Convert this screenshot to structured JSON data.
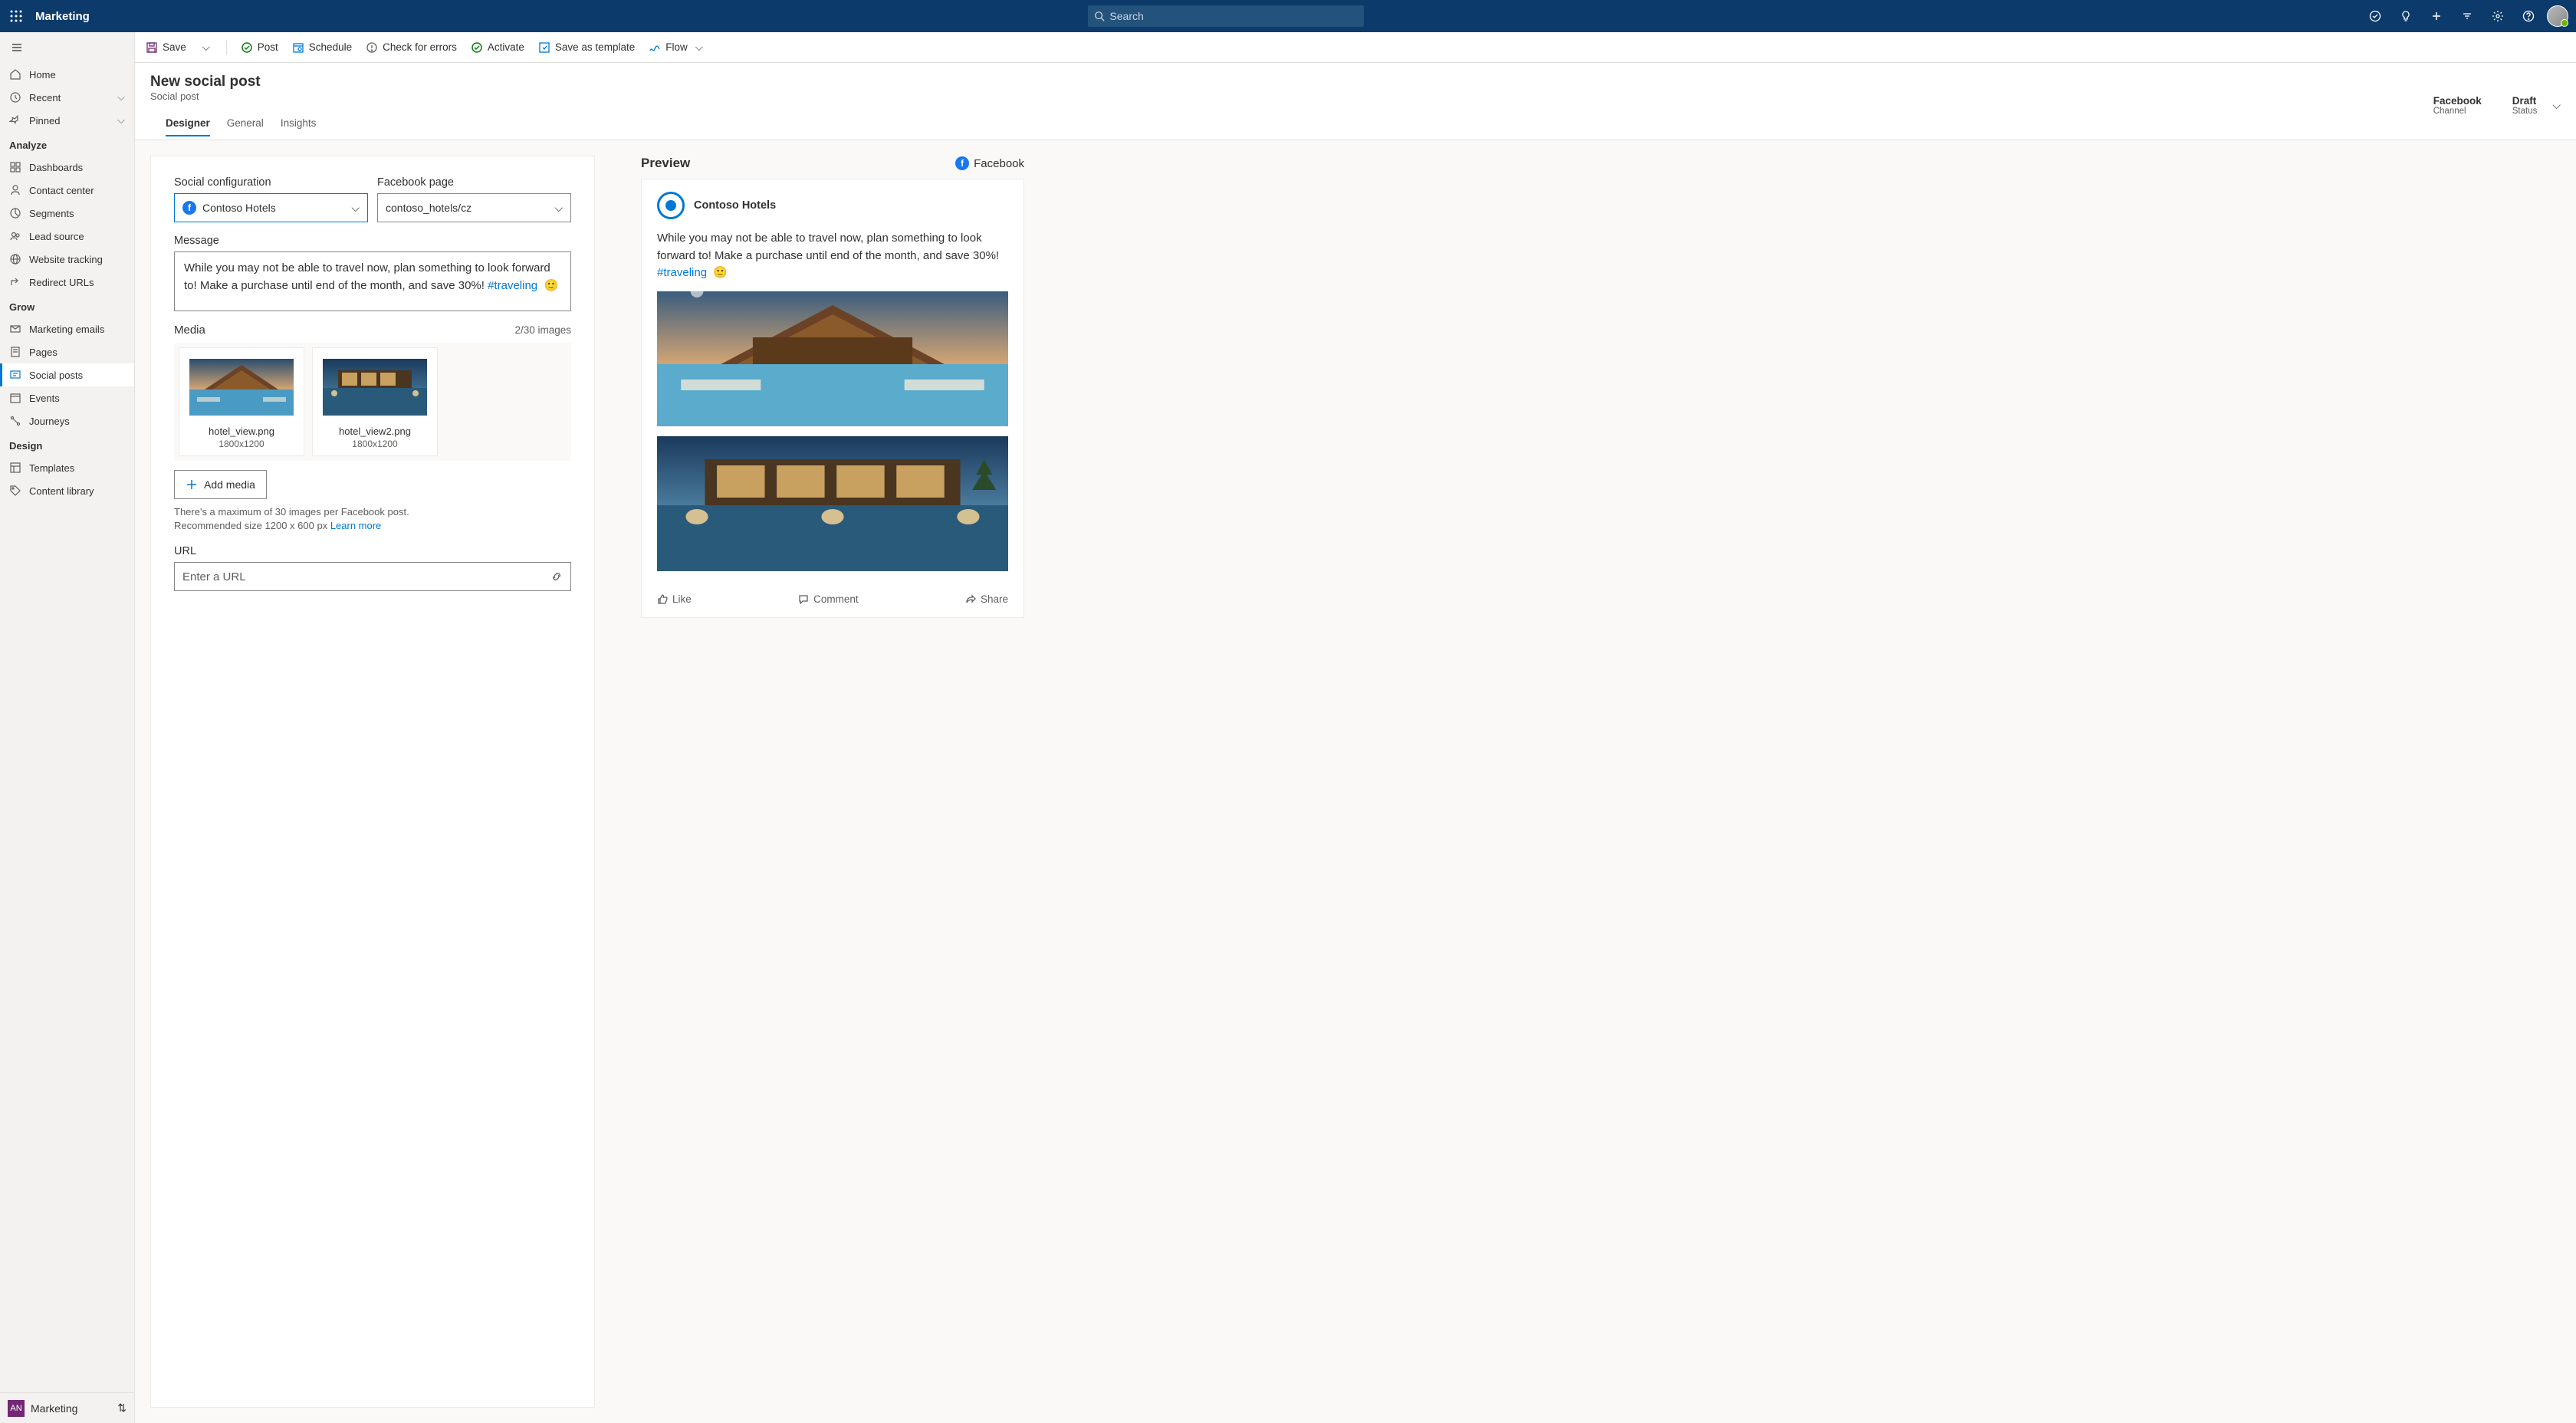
{
  "topbar": {
    "app_name": "Marketing",
    "search_placeholder": "Search"
  },
  "sidebar": {
    "home": "Home",
    "recent": "Recent",
    "pinned": "Pinned",
    "section_analyze": "Analyze",
    "analyze_items": [
      "Dashboards",
      "Contact center",
      "Segments",
      "Lead source",
      "Website tracking",
      "Redirect URLs"
    ],
    "section_grow": "Grow",
    "grow_items": [
      "Marketing emails",
      "Pages",
      "Social posts",
      "Events",
      "Journeys"
    ],
    "section_design": "Design",
    "design_items": [
      "Templates",
      "Content library"
    ],
    "footer_badge": "AN",
    "footer_label": "Marketing"
  },
  "cmdbar": {
    "save": "Save",
    "post": "Post",
    "schedule": "Schedule",
    "check": "Check for errors",
    "activate": "Activate",
    "save_tpl": "Save as template",
    "flow": "Flow"
  },
  "header": {
    "title": "New social post",
    "subtitle": "Social post",
    "channel_value": "Facebook",
    "channel_label": "Channel",
    "status_value": "Draft",
    "status_label": "Status"
  },
  "tabs": [
    "Designer",
    "General",
    "Insights"
  ],
  "form": {
    "social_config_label": "Social configuration",
    "social_config_value": "Contoso Hotels",
    "fb_page_label": "Facebook page",
    "fb_page_value": "contoso_hotels/cz",
    "message_label": "Message",
    "message_text": "While you may not be able to travel now, plan something to look forward to! Make a purchase until end of the month, and save 30%!",
    "message_hashtag": "#traveling",
    "media_label": "Media",
    "media_count": "2/30 images",
    "media": [
      {
        "filename": "hotel_view.png",
        "dimensions": "1800x1200"
      },
      {
        "filename": "hotel_view2.png",
        "dimensions": "1800x1200"
      }
    ],
    "add_media": "Add media",
    "hint_line1": "There's a maximum of 30 images per Facebook post.",
    "hint_line2": "Recommended size 1200 x 600 px",
    "learn_more": "Learn more",
    "url_label": "URL",
    "url_placeholder": "Enter a URL"
  },
  "preview": {
    "title": "Preview",
    "channel": "Facebook",
    "author": "Contoso Hotels",
    "body": "While you may not be able to travel now, plan something to look forward to! Make a purchase until end of the month, and save 30%!",
    "hashtag": "#traveling",
    "like": "Like",
    "comment": "Comment",
    "share": "Share"
  }
}
